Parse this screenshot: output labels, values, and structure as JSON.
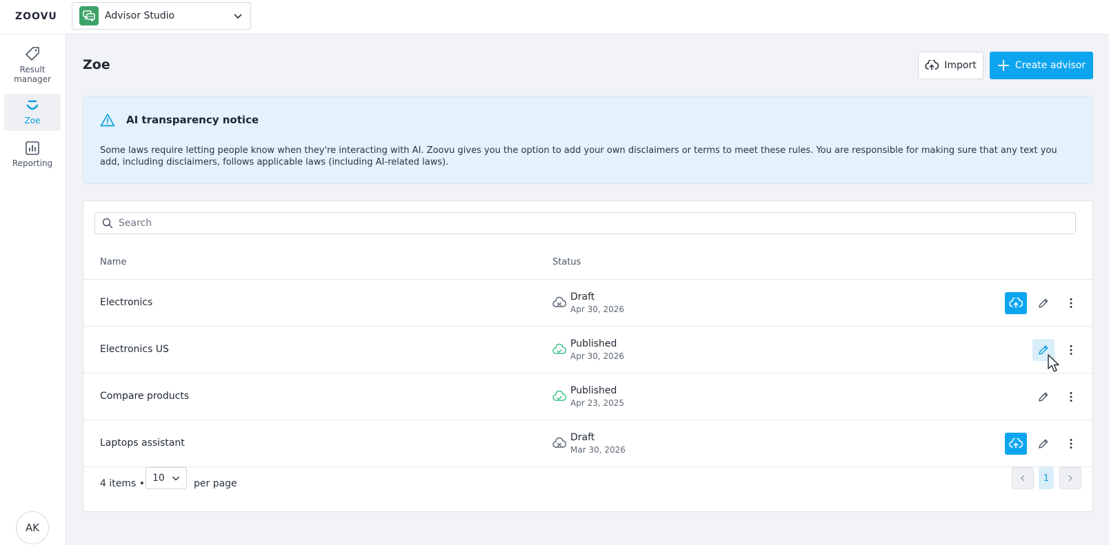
{
  "topbar": {
    "logo": "ZOOVU",
    "app_switcher": {
      "name": "Advisor Studio"
    }
  },
  "sidebar": {
    "items": [
      {
        "label": "Result manager",
        "icon": "tag-icon"
      },
      {
        "label": "Zoe",
        "icon": "zoe-icon",
        "active": true
      },
      {
        "label": "Reporting",
        "icon": "chart-icon"
      }
    ],
    "avatar": "AK"
  },
  "page": {
    "title": "Zoe",
    "import_label": "Import",
    "create_label": "Create advisor"
  },
  "notice": {
    "title": "AI transparency notice",
    "body": "Some laws require letting people know when they're interacting with AI. Zoovu gives you the option to add your own disclaimers or terms to meet these rules. You are responsible for making sure that any text you add, including disclaimers, follows applicable laws (including AI-related laws)."
  },
  "table": {
    "search_placeholder": "Search",
    "columns": {
      "name": "Name",
      "status": "Status"
    },
    "rows": [
      {
        "name": "Electronics",
        "status": "Draft",
        "date": "Apr 30, 2026",
        "publishable": true
      },
      {
        "name": "Electronics US",
        "status": "Published",
        "date": "Apr 30, 2026",
        "publishable": false
      },
      {
        "name": "Compare products",
        "status": "Published",
        "date": "Apr 23, 2025",
        "publishable": false
      },
      {
        "name": "Laptops assistant",
        "status": "Draft",
        "date": "Mar 30, 2026",
        "publishable": true
      }
    ]
  },
  "pagination": {
    "count": "4 items •",
    "per_page_value": "10",
    "per_page_label": "per page",
    "current_page": "1"
  },
  "colors": {
    "accent": "#0ea5ef",
    "published": "#3ec28a",
    "draft": "#5d6672"
  }
}
